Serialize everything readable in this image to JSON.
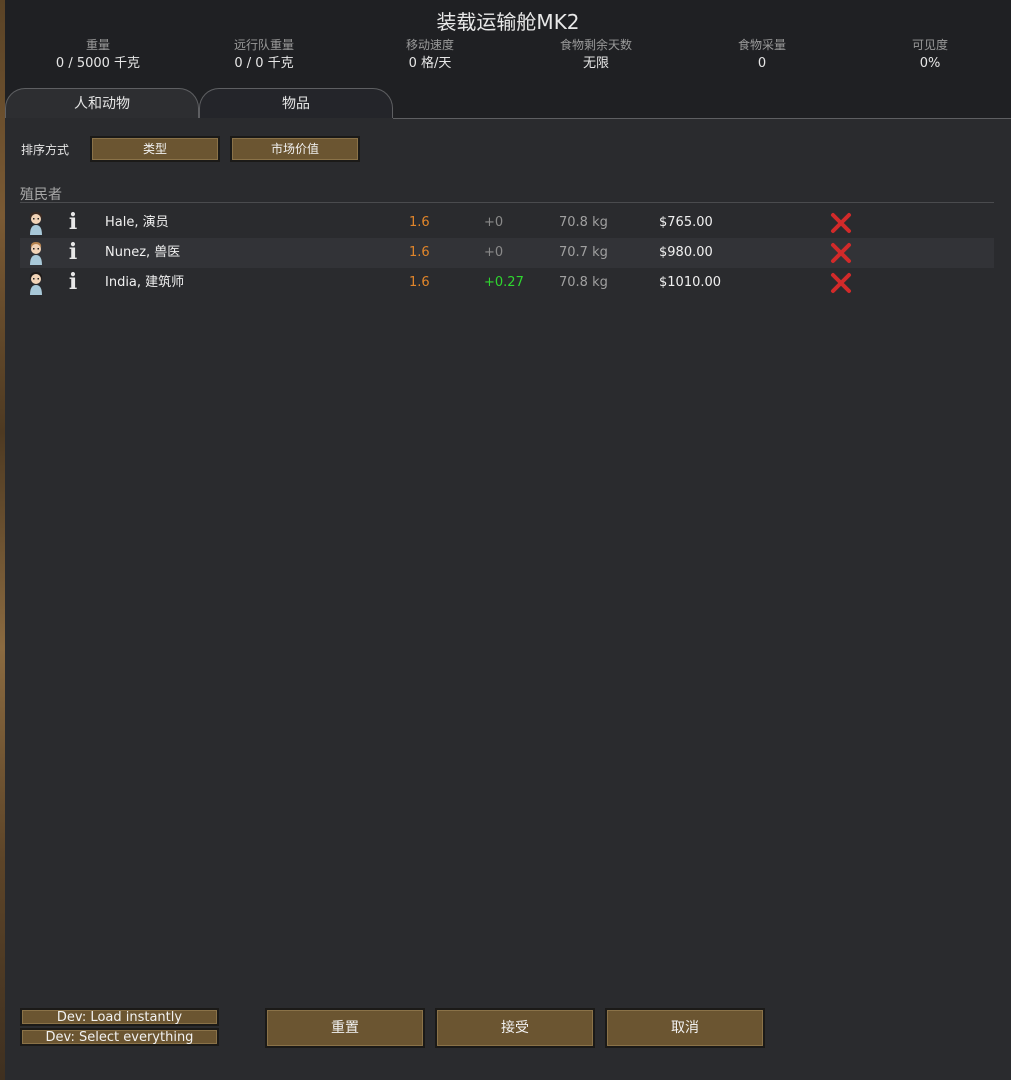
{
  "title": "装载运输舱MK2",
  "stats": [
    {
      "label": "重量",
      "value": "0 / 5000 千克"
    },
    {
      "label": "远行队重量",
      "value": "0 / 0 千克"
    },
    {
      "label": "移动速度",
      "value": "0 格/天"
    },
    {
      "label": "食物剩余天数",
      "value": "无限"
    },
    {
      "label": "食物采量",
      "value": "0"
    },
    {
      "label": "可见度",
      "value": "0%"
    }
  ],
  "tabs": [
    {
      "label": "人和动物",
      "active": true
    },
    {
      "label": "物品",
      "active": false
    }
  ],
  "sort": {
    "label": "排序方式",
    "options": [
      "类型",
      "市场价值"
    ]
  },
  "section": {
    "title": "殖民者"
  },
  "colonists": [
    {
      "name": "Hale, 演员",
      "speed": "1.6",
      "delta": "+0",
      "mass": "70.8 kg",
      "value": "$765.00"
    },
    {
      "name": "Nunez, 兽医",
      "speed": "1.6",
      "delta": "+0",
      "mass": "70.7 kg",
      "value": "$980.00"
    },
    {
      "name": "India, 建筑师",
      "speed": "1.6",
      "delta": "+0.27",
      "mass": "70.8 kg",
      "value": "$1010.00"
    }
  ],
  "dev_buttons": [
    "Dev: Load instantly",
    "Dev: Select everything"
  ],
  "actions": {
    "reset": "重置",
    "accept": "接受",
    "cancel": "取消"
  },
  "colors": {
    "speed": "#e0852a",
    "delta_positive": "#2fd72f",
    "delta_zero": "#8a8a8a",
    "mass": "#a0a0a0",
    "value": "#f0f0f0",
    "remove": "#d22a2a",
    "button": "#6b5531"
  },
  "icons": {
    "avatar": "pawn-portrait-icon",
    "info": "info-icon",
    "remove": "remove-x-icon"
  }
}
